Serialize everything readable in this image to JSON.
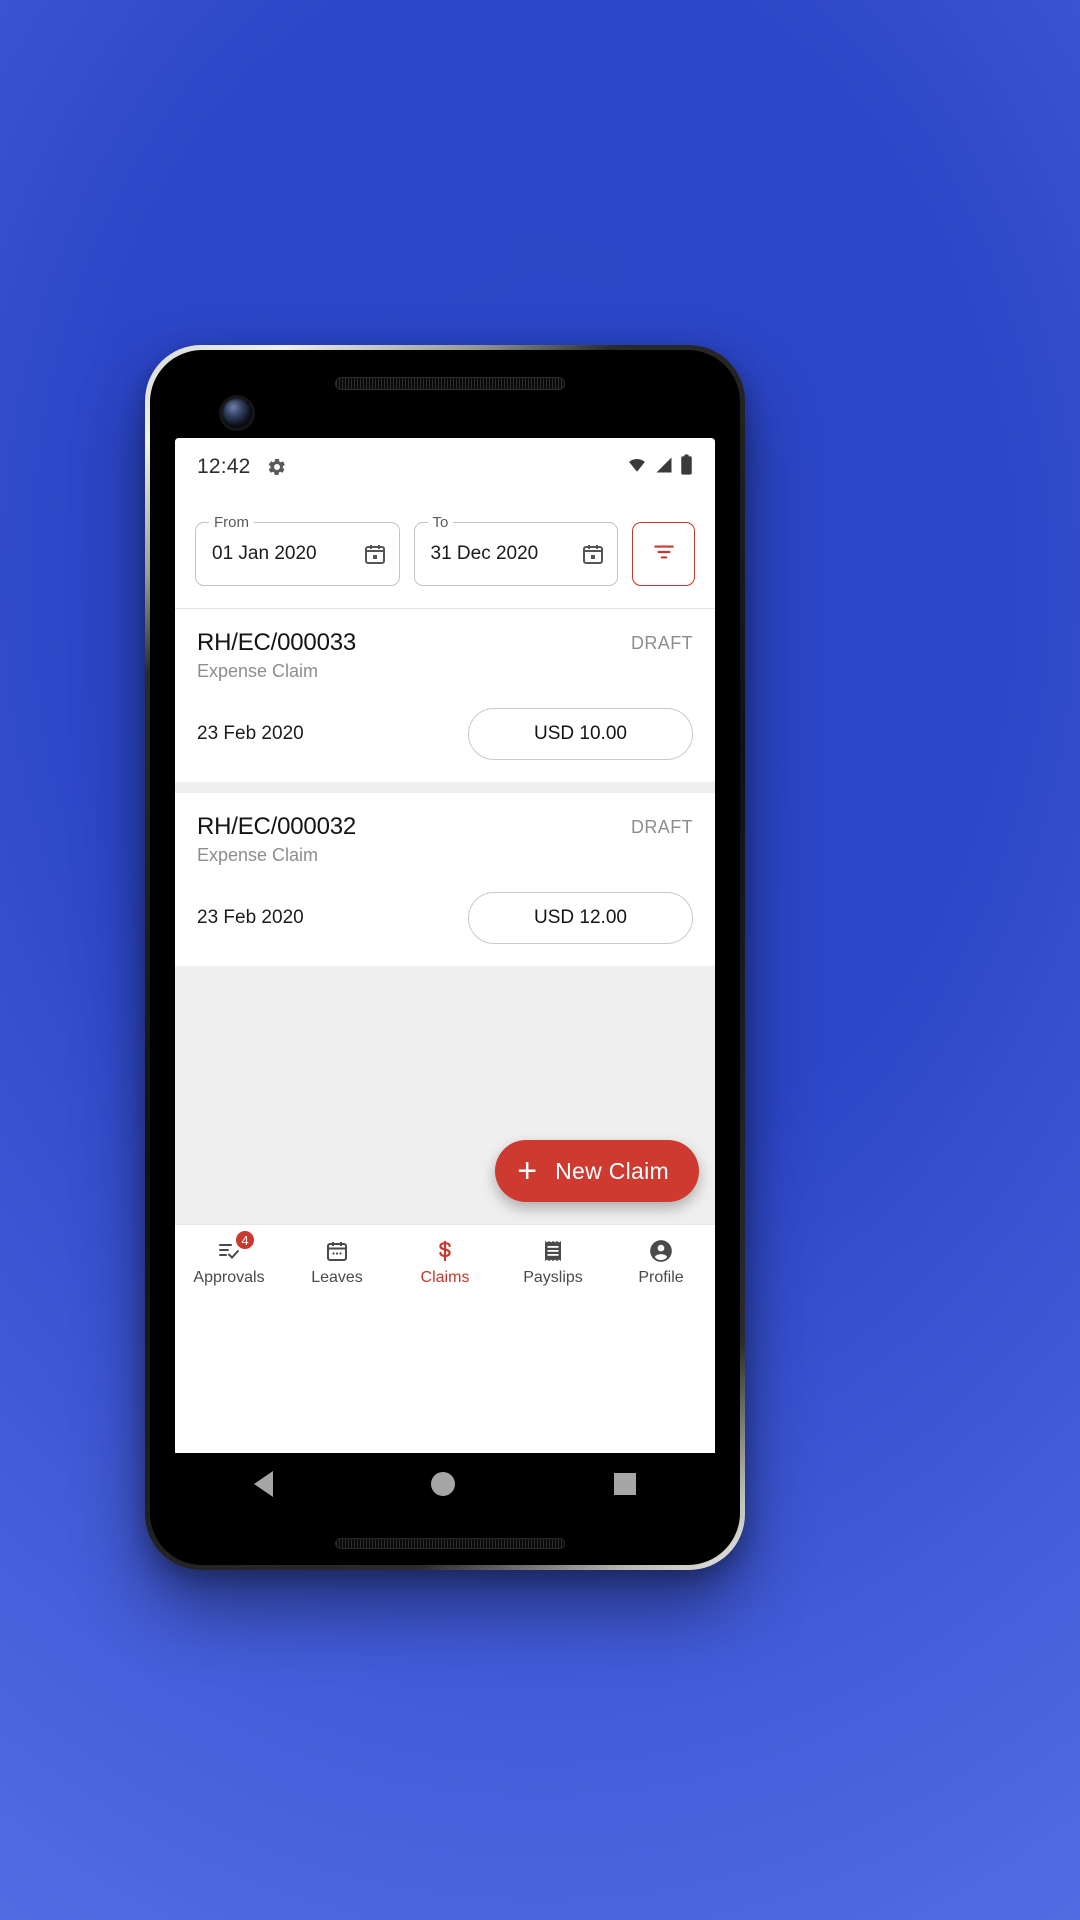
{
  "status_bar": {
    "time": "12:42",
    "gear_icon": "gear-icon",
    "wifi_icon": "wifi-icon",
    "signal_icon": "cellular-signal-icon",
    "battery_icon": "battery-icon"
  },
  "filter_bar": {
    "from": {
      "label": "From",
      "value": "01 Jan 2020",
      "icon": "calendar-icon"
    },
    "to": {
      "label": "To",
      "value": "31 Dec 2020",
      "icon": "calendar-icon"
    },
    "filter_button_icon": "filter-icon"
  },
  "claims": [
    {
      "id": "RH/EC/000033",
      "status": "DRAFT",
      "type": "Expense Claim",
      "date": "23 Feb 2020",
      "amount": "USD 10.00"
    },
    {
      "id": "RH/EC/000032",
      "status": "DRAFT",
      "type": "Expense Claim",
      "date": "23 Feb 2020",
      "amount": "USD 12.00"
    }
  ],
  "fab": {
    "plus": "+",
    "label": "New Claim"
  },
  "bottom_nav": [
    {
      "label": "Approvals",
      "icon": "checklist-icon",
      "badge": "4",
      "active": false
    },
    {
      "label": "Leaves",
      "icon": "calendar-icon",
      "badge": "",
      "active": false
    },
    {
      "label": "Claims",
      "icon": "dollar-icon",
      "badge": "",
      "active": true
    },
    {
      "label": "Payslips",
      "icon": "receipt-icon",
      "badge": "",
      "active": false
    },
    {
      "label": "Profile",
      "icon": "account-circle-icon",
      "badge": "",
      "active": false
    }
  ],
  "android_nav": {
    "back": "back-triangle",
    "home": "home-circle",
    "recents": "recents-square"
  },
  "colors": {
    "accent": "#c8372d",
    "fab": "#ce3a30",
    "background": "#2c46c9",
    "list_bg": "#efefef"
  }
}
